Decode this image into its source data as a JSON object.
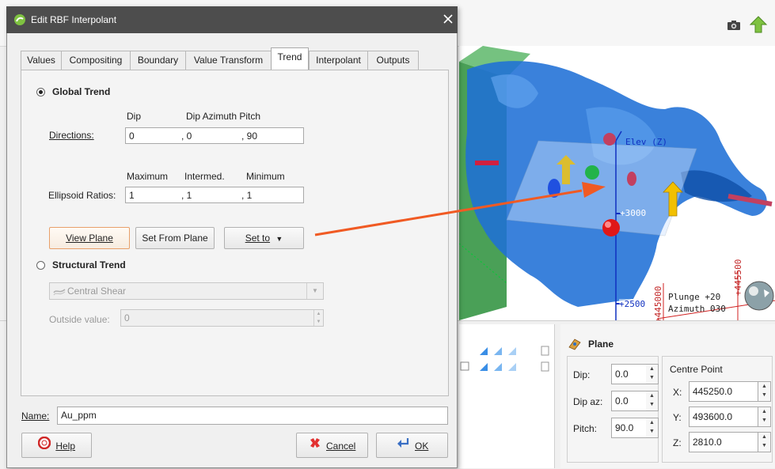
{
  "colors": {
    "accent": "#f05a23",
    "title_bar": "#4d4d4d",
    "mesh": "#1f6fd6"
  },
  "dialog": {
    "title": "Edit RBF Interpolant",
    "tabs": [
      {
        "label": "Values"
      },
      {
        "label": "Compositing"
      },
      {
        "label": "Boundary"
      },
      {
        "label": "Value Transform"
      },
      {
        "label": "Trend"
      },
      {
        "label": "Interpolant"
      },
      {
        "label": "Outputs"
      }
    ],
    "active_tab": "Trend",
    "global_trend": {
      "label": "Global Trend",
      "directions_label": "Directions:",
      "dir_headers": {
        "dip": "Dip",
        "dip_azimuth_pitch": "Dip Azimuth Pitch"
      },
      "dir_values": {
        "dip": "0",
        "dip_azimuth": ", 0",
        "pitch": ", 90"
      },
      "ratio_headers": {
        "maximum": "Maximum",
        "intermed": "Intermed.",
        "minimum": "Minimum"
      },
      "ratios_label": "Ellipsoid Ratios:",
      "ratio_values": {
        "maximum": "1",
        "intermed": ", 1",
        "minimum": ", 1"
      }
    },
    "buttons": {
      "view_plane": "View Plane",
      "set_from_plane": "Set From Plane",
      "set_to": "Set to"
    },
    "structural_trend": {
      "label": "Structural Trend",
      "select_value": "Central Shear",
      "outside_label": "Outside value:",
      "outside_value": "0"
    },
    "name_label": "Name:",
    "name_value": "Au_ppm",
    "footer": {
      "help": "Help",
      "cancel": "Cancel",
      "ok": "OK"
    }
  },
  "viewport": {
    "elev_label": "Elev (Z)",
    "tick_3000": "+3000",
    "tick_2500": "+2500",
    "tick_445000": "+445000",
    "tick_445500": "+445500",
    "plunge": "Plunge +20",
    "azimuth": "Azimuth 030"
  },
  "plane_panel": {
    "title": "Plane",
    "dip_label": "Dip:",
    "dip_value": "0.0",
    "dipaz_label": "Dip az:",
    "dipaz_value": "0.0",
    "pitch_label": "Pitch:",
    "pitch_value": "90.0",
    "centre_label": "Centre Point",
    "x_label": "X:",
    "x_value": "445250.0",
    "y_label": "Y:",
    "y_value": "493600.0",
    "z_label": "Z:",
    "z_value": "2810.0"
  }
}
